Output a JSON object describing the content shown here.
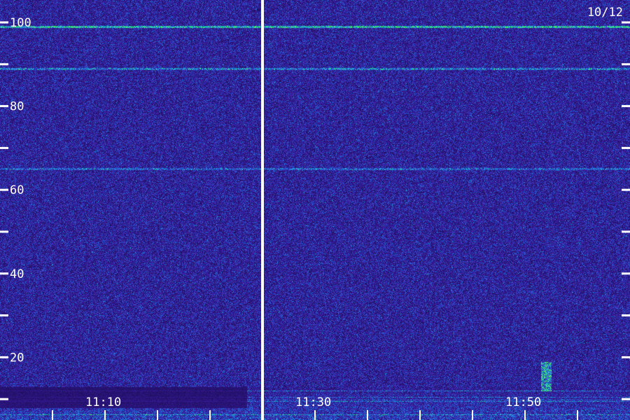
{
  "chart_data": {
    "type": "heatmap",
    "title": "",
    "xlabel": "",
    "ylabel": "",
    "date_label": "10/12",
    "ylim": [
      0,
      100
    ],
    "y_ticks_labeled": [
      "20",
      "40",
      "60",
      "80",
      "100"
    ],
    "y_ticks_minor": [
      10,
      30,
      50,
      70,
      90
    ],
    "x_tick_labels": [
      "11:10",
      "11:30",
      "11:50"
    ],
    "x_range": [
      "11:00",
      "11:59"
    ],
    "x_minor_tick_minutes": 5,
    "gap_time": "11:25",
    "colors": {
      "background": "#1e0e5c",
      "noise": "#3d1fa8",
      "signal_low": "#1f6fe0",
      "signal_mid": "#20c0c8",
      "signal_high": "#4cff4c",
      "divider": "#ffffff",
      "text": "#ffffff"
    },
    "features": [
      {
        "kind": "horizontal-line",
        "y": 99,
        "strength": 0.7
      },
      {
        "kind": "horizontal-line",
        "y": 89,
        "strength": 0.45
      },
      {
        "kind": "horizontal-line",
        "y": 65,
        "strength": 0.35
      },
      {
        "kind": "burst",
        "time": "11:52",
        "y_from": 12,
        "y_to": 19,
        "strength": 0.8
      },
      {
        "kind": "low-band",
        "y_from": 0,
        "y_to": 13,
        "strength": 0.75
      }
    ]
  }
}
